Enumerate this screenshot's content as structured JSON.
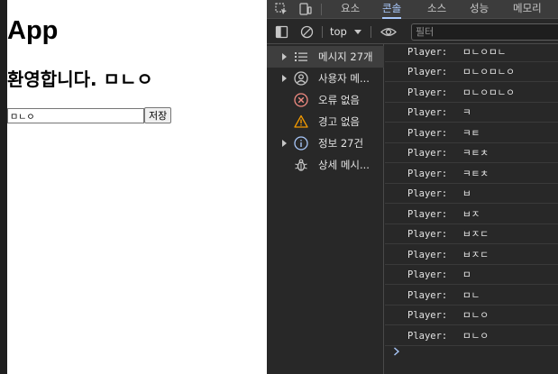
{
  "webpage": {
    "heading": "App",
    "welcome": "환영합니다. ㅁㄴㅇ",
    "input_value": "ㅁㄴㅇ",
    "save_label": "저장"
  },
  "devtools": {
    "tabs": [
      {
        "label": "요소",
        "active": false
      },
      {
        "label": "콘솔",
        "active": true
      },
      {
        "label": "소스",
        "active": false
      },
      {
        "label": "성능",
        "active": false
      },
      {
        "label": "메모리",
        "active": false
      }
    ],
    "toolbar": {
      "context": "top",
      "filter_placeholder": "필터"
    },
    "sidebar": [
      {
        "label": "메시지 27개",
        "icon": "list-icon",
        "expandable": true,
        "selected": true
      },
      {
        "label": "사용자 메...",
        "icon": "user-icon",
        "expandable": true,
        "selected": false
      },
      {
        "label": "오류 없음",
        "icon": "error-icon",
        "expandable": false,
        "selected": false
      },
      {
        "label": "경고 없음",
        "icon": "warning-icon",
        "expandable": false,
        "selected": false
      },
      {
        "label": "정보 27건",
        "icon": "info-icon",
        "expandable": true,
        "selected": false
      },
      {
        "label": "상세 메시...",
        "icon": "bug-icon",
        "expandable": false,
        "selected": false
      }
    ],
    "messages": [
      {
        "prefix": "Player:",
        "value": "ㅁㄴㅇㅁㄴ"
      },
      {
        "prefix": "Player:",
        "value": "ㅁㄴㅇㅁㄴㅇ"
      },
      {
        "prefix": "Player:",
        "value": "ㅁㄴㅇㅁㄴㅇ"
      },
      {
        "prefix": "Player:",
        "value": "ㅋ"
      },
      {
        "prefix": "Player:",
        "value": "ㅋㅌ"
      },
      {
        "prefix": "Player:",
        "value": "ㅋㅌㅊ"
      },
      {
        "prefix": "Player:",
        "value": "ㅋㅌㅊ"
      },
      {
        "prefix": "Player:",
        "value": "ㅂ"
      },
      {
        "prefix": "Player:",
        "value": "ㅂㅈ"
      },
      {
        "prefix": "Player:",
        "value": "ㅂㅈㄷ"
      },
      {
        "prefix": "Player:",
        "value": "ㅂㅈㄷ"
      },
      {
        "prefix": "Player:",
        "value": "ㅁ"
      },
      {
        "prefix": "Player:",
        "value": "ㅁㄴ"
      },
      {
        "prefix": "Player:",
        "value": "ㅁㄴㅇ"
      },
      {
        "prefix": "Player:",
        "value": "ㅁㄴㅇ"
      }
    ],
    "colors": {
      "accent": "#a8c7fa",
      "error": "#f28b82",
      "warning": "#f29900",
      "info": "#a8c7fa"
    }
  }
}
